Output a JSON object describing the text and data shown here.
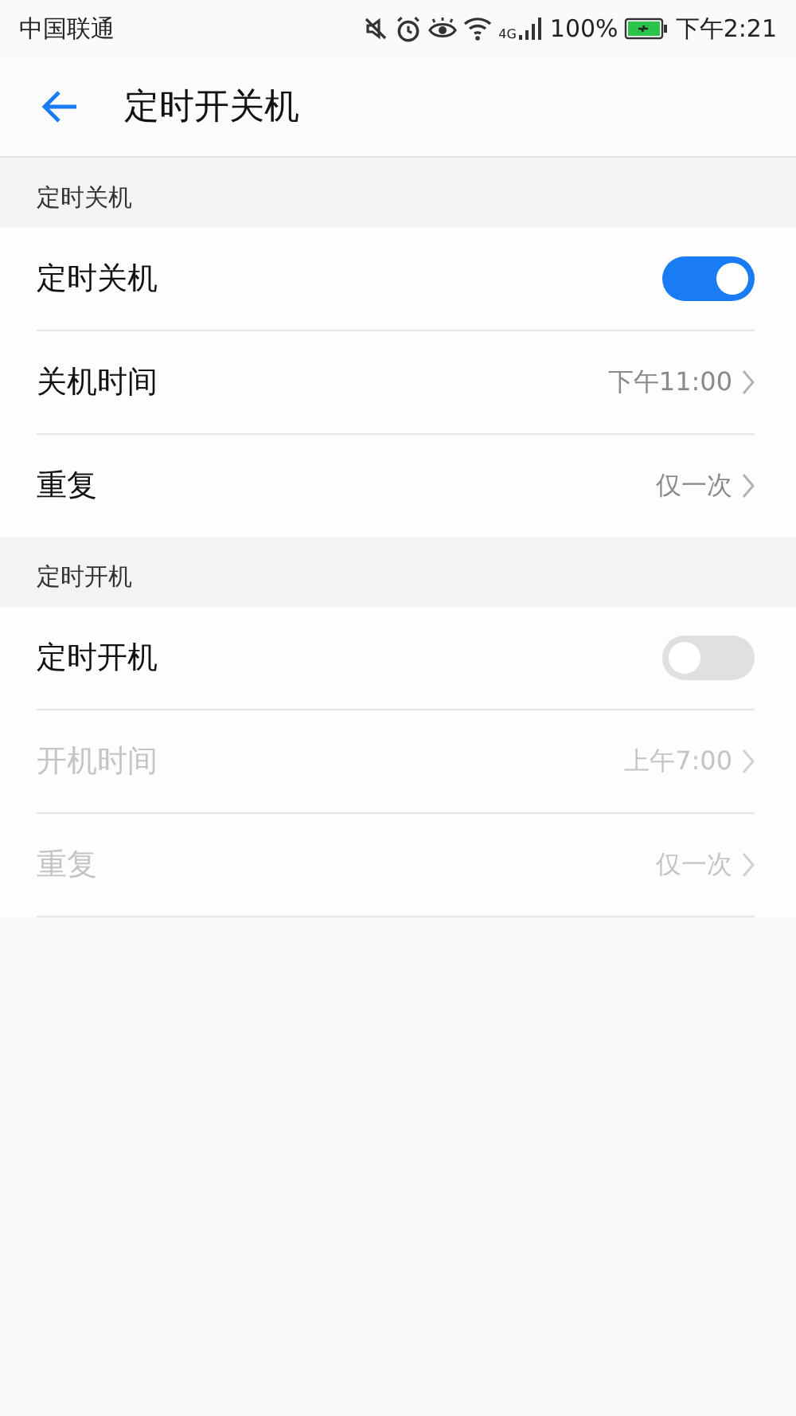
{
  "status_bar": {
    "carrier": "中国联通",
    "network": "4G",
    "battery": "100%",
    "time": "下午2:21"
  },
  "header": {
    "title": "定时开关机"
  },
  "sections": [
    {
      "title": "定时关机",
      "rows": [
        {
          "kind": "toggle",
          "label": "定时关机",
          "on": true,
          "disabled": false
        },
        {
          "kind": "link",
          "label": "关机时间",
          "value": "下午11:00",
          "disabled": false
        },
        {
          "kind": "link",
          "label": "重复",
          "value": "仅一次",
          "disabled": false
        }
      ]
    },
    {
      "title": "定时开机",
      "rows": [
        {
          "kind": "toggle",
          "label": "定时开机",
          "on": false,
          "disabled": false
        },
        {
          "kind": "link",
          "label": "开机时间",
          "value": "上午7:00",
          "disabled": true
        },
        {
          "kind": "link",
          "label": "重复",
          "value": "仅一次",
          "disabled": true
        }
      ]
    }
  ]
}
